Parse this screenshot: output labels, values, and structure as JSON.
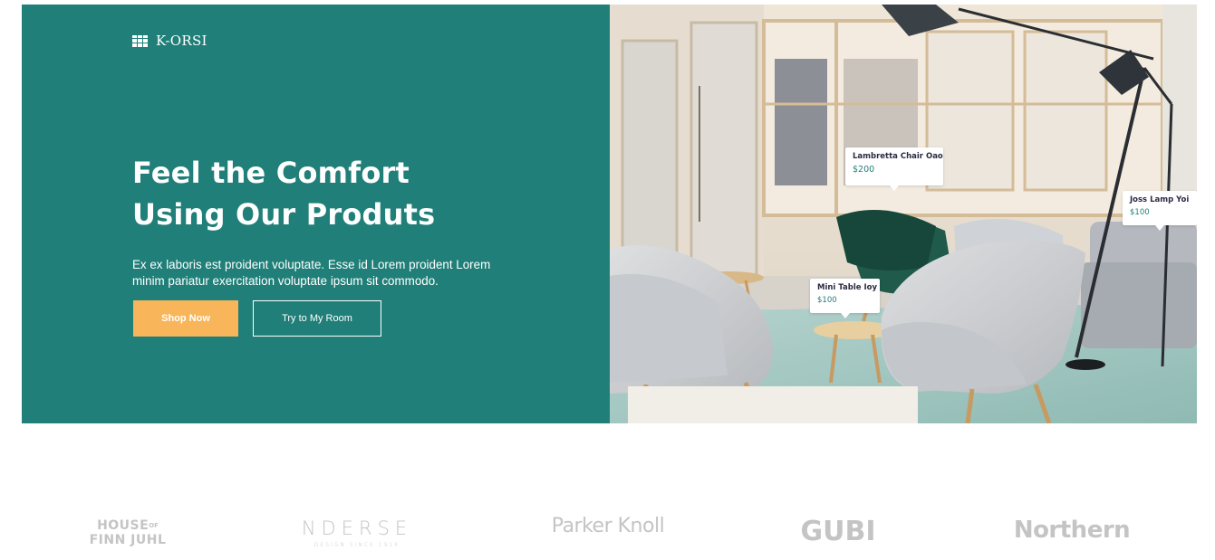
{
  "brand": {
    "name": "K-ORSI",
    "icon": "grid-icon"
  },
  "hero": {
    "headline_line1": "Feel the Comfort",
    "headline_line2": "Using Our Produts",
    "description": "Ex ex laboris est proident voluptate. Esse id Lorem proident Lorem minim pariatur exercitation voluptate ipsum sit commodo.",
    "shop_button": "Shop Now",
    "try_button": "Try to My Room"
  },
  "product_tags": [
    {
      "name": "Lambretta Chair Oao",
      "price": "$200"
    },
    {
      "name": "Joss Lamp Yoi",
      "price": "$100"
    },
    {
      "name": "Mini Table Ioy",
      "price": "$100"
    }
  ],
  "partners": {
    "house_line1": "HOUSE",
    "house_of": "OF",
    "house_line2": "FINN JUHL",
    "nderse": "NDERSE",
    "nderse_sub": "DESIGN SINCE 1916",
    "parker": "Parker Knoll",
    "gubi": "GUBI",
    "northern": "Northern"
  },
  "colors": {
    "hero_green": "#207f78",
    "accent_orange": "#f8b55a",
    "price_teal": "#207f78",
    "partner_gray": "#c4c4c4"
  }
}
